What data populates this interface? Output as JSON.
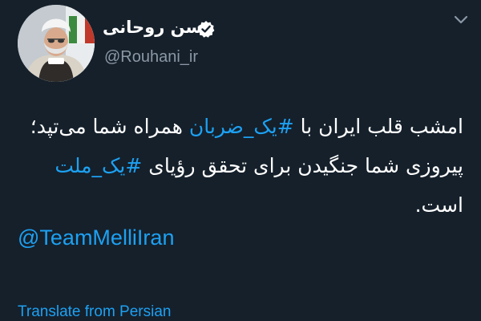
{
  "tweet": {
    "author": {
      "display_name": "حسن روحانی",
      "handle": "@Rouhani_ir",
      "verified_icon": "verified-badge-icon",
      "avatar_icon": "profile-avatar"
    },
    "menu_icon": "chevron-down-icon",
    "lines": [
      {
        "parts": [
          {
            "text": "امشب قلب ایران با ",
            "kind": "text"
          },
          {
            "text": "#یک_ضربان",
            "kind": "hashtag"
          },
          {
            "text": " همراه شما می‌تپد؛",
            "kind": "text"
          }
        ]
      },
      {
        "parts": [
          {
            "text": "پیروزی شما جنگیدن برای تحقق رؤیای ",
            "kind": "text"
          },
          {
            "text": "#یک_ملت",
            "kind": "hashtag"
          }
        ]
      },
      {
        "parts": [
          {
            "text": "است.",
            "kind": "text"
          }
        ]
      }
    ],
    "mention": "@TeamMelliIran",
    "translate_label": "Translate from Persian"
  },
  "colors": {
    "background": "#15202b",
    "text": "#ffffff",
    "secondary_text": "#8b98a5",
    "link": "#1da1f2"
  }
}
